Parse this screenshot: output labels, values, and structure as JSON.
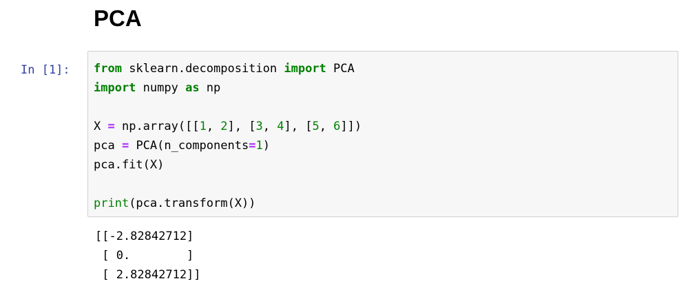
{
  "notebook": {
    "heading": "PCA",
    "cell": {
      "prompt": "In [1]:",
      "code_lines": [
        [
          {
            "t": "from",
            "c": "kw"
          },
          {
            "t": " sklearn.decomposition "
          },
          {
            "t": "import",
            "c": "kw"
          },
          {
            "t": " PCA"
          }
        ],
        [
          {
            "t": "import",
            "c": "kw"
          },
          {
            "t": " numpy "
          },
          {
            "t": "as",
            "c": "kw"
          },
          {
            "t": " np"
          }
        ],
        [],
        [
          {
            "t": "X "
          },
          {
            "t": "=",
            "c": "op"
          },
          {
            "t": " np.array([["
          },
          {
            "t": "1",
            "c": "num"
          },
          {
            "t": ", "
          },
          {
            "t": "2",
            "c": "num"
          },
          {
            "t": "], ["
          },
          {
            "t": "3",
            "c": "num"
          },
          {
            "t": ", "
          },
          {
            "t": "4",
            "c": "num"
          },
          {
            "t": "], ["
          },
          {
            "t": "5",
            "c": "num"
          },
          {
            "t": ", "
          },
          {
            "t": "6",
            "c": "num"
          },
          {
            "t": "]])"
          }
        ],
        [
          {
            "t": "pca "
          },
          {
            "t": "=",
            "c": "op"
          },
          {
            "t": " PCA(n_components"
          },
          {
            "t": "=",
            "c": "op"
          },
          {
            "t": "1",
            "c": "num"
          },
          {
            "t": ")"
          }
        ],
        [
          {
            "t": "pca.fit(X)"
          }
        ],
        [],
        [
          {
            "t": "print",
            "c": "bi"
          },
          {
            "t": "(pca.transform(X))"
          }
        ]
      ],
      "output_lines": [
        "[[-2.82842712]",
        " [ 0.        ]",
        " [ 2.82842712]]"
      ]
    }
  },
  "colors": {
    "keyword": "#008000",
    "operator": "#aa22ff",
    "prompt": "#303f9f",
    "input_background": "#f7f7f7",
    "input_border": "#cfcfcf"
  }
}
